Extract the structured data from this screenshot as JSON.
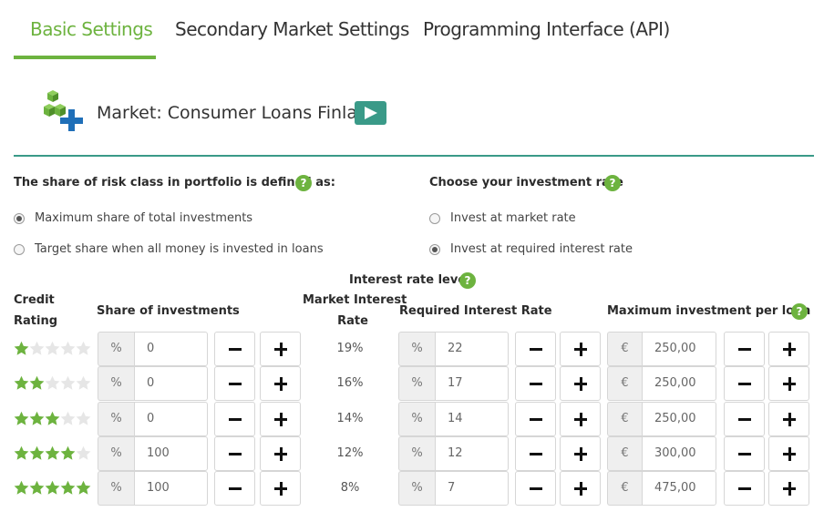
{
  "tabs": [
    {
      "label": "Basic Settings",
      "active": true
    },
    {
      "label": "Secondary Market Settings",
      "active": false
    },
    {
      "label": "Programming Interface (API)",
      "active": false
    }
  ],
  "market": {
    "label": "Market: Consumer Loans Finland"
  },
  "risk_share": {
    "heading": "The share of risk class in portfolio is defined as:",
    "options": [
      {
        "label": "Maximum share of total investments",
        "checked": true
      },
      {
        "label": "Target share when all money is invested in loans",
        "checked": false
      }
    ]
  },
  "investment_rate": {
    "heading": "Choose your investment rate",
    "options": [
      {
        "label": "Invest at market rate",
        "checked": false
      },
      {
        "label": "Invest at required interest rate",
        "checked": true
      }
    ]
  },
  "help_glyph": "?",
  "table": {
    "interest_rate_level": "Interest rate level",
    "headers": {
      "credit_rating_1": "Credit",
      "credit_rating_2": "Rating",
      "share": "Share of investments",
      "market_rate_1": "Market Interest",
      "market_rate_2": "Rate",
      "required_rate": "Required Interest Rate",
      "max_investment": "Maximum investment per loan"
    },
    "units": {
      "percent": "%",
      "euro": "€"
    },
    "rows": [
      {
        "stars": 1,
        "share": "0",
        "market_rate": "19%",
        "required_rate": "22",
        "max_investment": "250,00"
      },
      {
        "stars": 2,
        "share": "0",
        "market_rate": "16%",
        "required_rate": "17",
        "max_investment": "250,00"
      },
      {
        "stars": 3,
        "share": "0",
        "market_rate": "14%",
        "required_rate": "14",
        "max_investment": "250,00"
      },
      {
        "stars": 4,
        "share": "100",
        "market_rate": "12%",
        "required_rate": "12",
        "max_investment": "300,00"
      },
      {
        "stars": 5,
        "share": "100",
        "market_rate": "8%",
        "required_rate": "7",
        "max_investment": "475,00"
      }
    ]
  },
  "colors": {
    "accent_green": "#6db33f",
    "teal": "#3a9a88",
    "star_empty": "#e6e6e6"
  },
  "icons": {
    "market": "market-blocks-plus-icon",
    "play": "play-icon",
    "help": "help-icon",
    "star": "star-icon",
    "minus": "minus-icon",
    "plus": "plus-icon"
  }
}
